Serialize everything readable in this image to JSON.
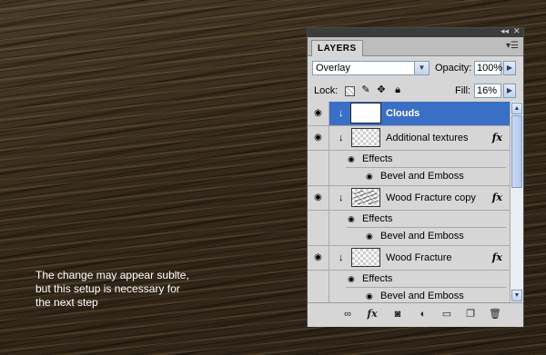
{
  "caption": {
    "line1": "The change may appear sublte,",
    "line2": "but this setup is necessary for",
    "line3": "the next step"
  },
  "panel": {
    "window_controls": {
      "collapse": "◂◂",
      "close": "✕"
    },
    "tab_label": "LAYERS",
    "menu_icon": "panel-menu-icon",
    "blend_mode": "Overlay",
    "opacity_label": "Opacity:",
    "opacity_value": "100%",
    "lock_label": "Lock:",
    "fill_label": "Fill:",
    "fill_value": "16%",
    "selection_color": "#3a6fc6",
    "layers": [
      {
        "name": "Clouds",
        "selected": true,
        "visible": true,
        "clipped": true,
        "has_fx": false
      },
      {
        "name": "Additional textures",
        "selected": false,
        "visible": true,
        "clipped": true,
        "has_fx": true,
        "effects_label": "Effects",
        "effects": [
          "Bevel and Emboss"
        ]
      },
      {
        "name": "Wood Fracture copy",
        "selected": false,
        "visible": true,
        "clipped": true,
        "has_fx": true,
        "effects_label": "Effects",
        "effects": [
          "Bevel and Emboss"
        ]
      },
      {
        "name": "Wood Fracture",
        "selected": false,
        "visible": true,
        "clipped": true,
        "has_fx": true,
        "effects_label": "Effects",
        "effects": [
          "Bevel and Emboss"
        ]
      }
    ],
    "fx_label": "fx",
    "bottom_icons": [
      "link-layers-icon",
      "add-layer-style-icon",
      "add-mask-icon",
      "adjustment-layer-icon",
      "new-group-icon",
      "new-layer-icon",
      "delete-layer-icon"
    ]
  }
}
